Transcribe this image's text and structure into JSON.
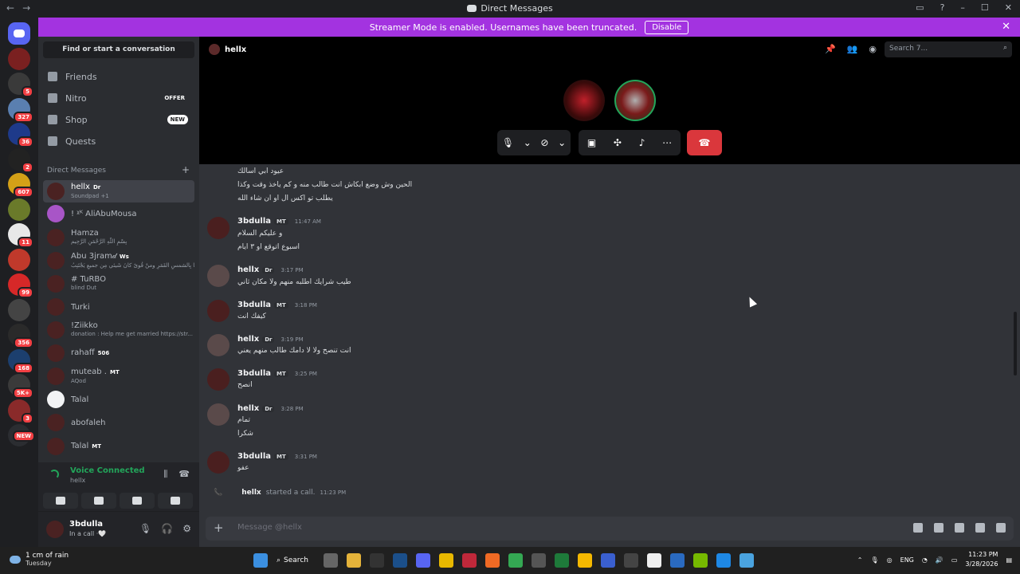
{
  "titlebar": {
    "title": "Direct Messages",
    "back": "←",
    "forward": "→"
  },
  "banner": {
    "text": "Streamer Mode is enabled. Usernames have been truncated.",
    "disable_label": "Disable",
    "close": "✕"
  },
  "guilds": [
    {
      "badge": "",
      "color": "#5865f2"
    },
    {
      "badge": "",
      "color": "#7a2020"
    },
    {
      "badge": "5",
      "color": "#3a3a3a"
    },
    {
      "badge": "327",
      "color": "#5a7fb0"
    },
    {
      "badge": "36",
      "color": "#1e3a8a"
    },
    {
      "badge": "2",
      "color": "#222222"
    },
    {
      "badge": "607",
      "color": "#d4a017"
    },
    {
      "badge": "",
      "color": "#6a7a2a"
    },
    {
      "badge": "11",
      "color": "#e8e8e8"
    },
    {
      "badge": "",
      "color": "#c0392b"
    },
    {
      "badge": "99",
      "color": "#d62828"
    },
    {
      "badge": "",
      "color": "#444444"
    },
    {
      "badge": "356",
      "color": "#2a2a2a"
    },
    {
      "badge": "168",
      "color": "#1c3f6e"
    },
    {
      "badge": "5K+",
      "color": "#3a3a3a"
    },
    {
      "badge": "3",
      "color": "#8a2a2a"
    },
    {
      "badge": "NEW",
      "color": "#2b2d31"
    }
  ],
  "sidebar": {
    "find_label": "Find or start a conversation",
    "nav": [
      {
        "label": "Friends",
        "tag": ""
      },
      {
        "label": "Nitro",
        "tag": "OFFER"
      },
      {
        "label": "Shop",
        "tag": "NEW"
      },
      {
        "label": "Quests",
        "tag": ""
      }
    ],
    "dm_header": "Direct Messages",
    "dm_plus": "+",
    "dms": [
      {
        "name": "hellx",
        "chip": "Dr",
        "sub": "Soundpad +1",
        "style": "dark"
      },
      {
        "name": "! ᵡᴷ AliAbuMousa",
        "chip": "",
        "sub": "",
        "style": "purple"
      },
      {
        "name": "Hamza",
        "chip": "",
        "sub": "بِسْمِ اللَّهِ الرَّحْمَنِ الرَّحِيم",
        "style": "dark"
      },
      {
        "name": "Abu 3jram𝒹",
        "chip": "Ws",
        "sub": "أَيُّهَا بِالشمسِ القَمَرِ ومنْ قُوىً كانَ شَيئي مِن جميعِ يَجْتَنِبُ",
        "style": "dark"
      },
      {
        "name": "# TuRBO",
        "chip": "",
        "sub": "blind Dut",
        "style": "dark"
      },
      {
        "name": "Turki",
        "chip": "",
        "sub": "",
        "style": "dark"
      },
      {
        "name": "!Ziikko",
        "chip": "",
        "sub": "donation : Help me get married https://str...",
        "style": "dark"
      },
      {
        "name": "rahaff",
        "chip": "506",
        "sub": "",
        "style": "dark"
      },
      {
        "name": "muteab .",
        "chip": "MT",
        "sub": "AQod",
        "style": "dark"
      },
      {
        "name": "Talal",
        "chip": "",
        "sub": "",
        "style": "white"
      },
      {
        "name": "abofaleh",
        "chip": "",
        "sub": "",
        "style": "dark"
      },
      {
        "name": "Talal",
        "chip": "MT",
        "sub": "",
        "style": "dark"
      }
    ]
  },
  "voice": {
    "status": "Voice Connected",
    "channel": "hellx"
  },
  "user": {
    "name": "3bdulla",
    "status": "In a call ·🤍"
  },
  "channel": {
    "name": "hellx",
    "search_placeholder": "Search 7..."
  },
  "messages": [
    {
      "type": "cont",
      "lines": [
        "عيود ابي اسالك",
        "الحين وش وضع ابكاش انت طالب منه و كم ياخذ وقت وكذا",
        "يطلب تو اكس ال او ان شاء الله"
      ]
    },
    {
      "type": "msg",
      "author": "3bdulla",
      "tag": "MT",
      "time": "11:47 AM",
      "lines": [
        "و عليكم السلام",
        "اسبوع اتوقع او ٣ ايام"
      ]
    },
    {
      "type": "msg",
      "author": "hellx",
      "tag": "Dr",
      "time": "3:17 PM",
      "lines": [
        "طيب شرايك اطلبه منهم ولا مكان ثاني"
      ]
    },
    {
      "type": "msg",
      "author": "3bdulla",
      "tag": "MT",
      "time": "3:18 PM",
      "lines": [
        "كيفك انت"
      ]
    },
    {
      "type": "msg",
      "author": "hellx",
      "tag": "Dr",
      "time": "3:19 PM",
      "lines": [
        "انت تنصح ولا لا دامك طالب منهم يعني"
      ]
    },
    {
      "type": "msg",
      "author": "3bdulla",
      "tag": "MT",
      "time": "3:25 PM",
      "lines": [
        "انصح"
      ]
    },
    {
      "type": "msg",
      "author": "hellx",
      "tag": "Dr",
      "time": "3:28 PM",
      "lines": [
        "تمام",
        "شكرا"
      ]
    },
    {
      "type": "msg",
      "author": "3bdulla",
      "tag": "MT",
      "time": "3:31 PM",
      "lines": [
        "عفو"
      ]
    }
  ],
  "call_event": {
    "author": "hellx",
    "text": "started a call.",
    "time": "11:23 PM"
  },
  "composer": {
    "placeholder": "Message @hellx",
    "plus": "+"
  },
  "taskbar": {
    "weather": "1 cm of rain",
    "day": "Tuesday",
    "search": "Search",
    "lang": "ENG",
    "time": "11:23 PM",
    "date": "3/28/2026"
  }
}
